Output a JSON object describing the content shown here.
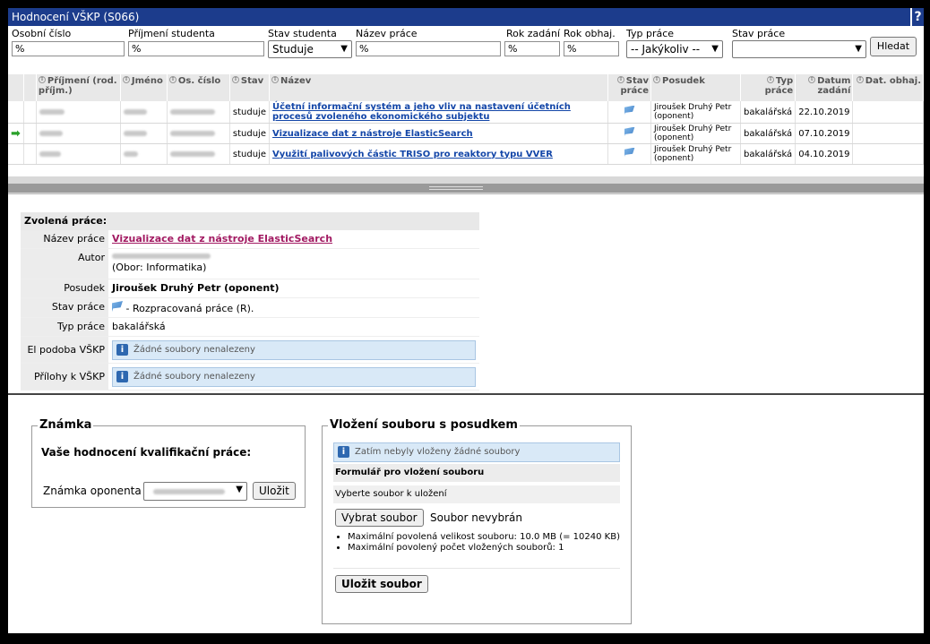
{
  "window_title": "Hodnocení VŠKP (S066)",
  "help_label": "?",
  "filters": {
    "osobni_cislo": {
      "label": "Osobní číslo",
      "value": "%"
    },
    "prijmeni": {
      "label": "Příjmení studenta",
      "value": "%"
    },
    "stav_studenta": {
      "label": "Stav studenta",
      "value": "Studuje"
    },
    "nazev_prace": {
      "label": "Název práce",
      "value": "%"
    },
    "rok_zadani": {
      "label": "Rok zadání",
      "value": "%"
    },
    "rok_obhaj": {
      "label": "Rok obhaj.",
      "value": "%"
    },
    "typ_prace": {
      "label": "Typ práce",
      "value": "-- Jakýkoliv --"
    },
    "stav_prace": {
      "label": "Stav práce",
      "value": ""
    },
    "search_button": "Hledat"
  },
  "table": {
    "headers": {
      "prijmeni": "Příjmení (rod. příjm.)",
      "jmeno": "Jméno",
      "os_cislo": "Os. číslo",
      "stav": "Stav",
      "nazev": "Název",
      "stav_prace": "Stav práce",
      "posudek": "Posudek",
      "typ_prace": "Typ práce",
      "datum_zadani": "Datum zadání",
      "dat_obhaj": "Dat. obhaj."
    },
    "rows": [
      {
        "stav": "studuje",
        "nazev": "Účetní informační systém a jeho vliv na nastavení účetních procesů zvoleného ekonomického subjektu",
        "posudek": "Jiroušek Druhý Petr (oponent)",
        "typ": "bakalářská",
        "datum": "22.10.2019",
        "selected": false
      },
      {
        "stav": "studuje",
        "nazev": "Vizualizace dat z nástroje ElasticSearch",
        "posudek": "Jiroušek Druhý Petr (oponent)",
        "typ": "bakalářská",
        "datum": "07.10.2019",
        "selected": true
      },
      {
        "stav": "studuje",
        "nazev": "Využití palivových částic TRISO pro reaktory typu VVER",
        "posudek": "Jiroušek Druhý Petr (oponent)",
        "typ": "bakalářská",
        "datum": "04.10.2019",
        "selected": false
      }
    ]
  },
  "detail": {
    "header": "Zvolená práce:",
    "nazev_label": "Název práce",
    "nazev_value": "Vizualizace dat z nástroje ElasticSearch",
    "autor_label": "Autor",
    "autor_obor": "(Obor: Informatika)",
    "posudek_label": "Posudek",
    "posudek_value": "Jiroušek Druhý Petr (oponent)",
    "stav_label": "Stav práce",
    "stav_value": " - Rozpracovaná práce (R).",
    "typ_label": "Typ práce",
    "typ_value": "bakalářská",
    "el_podoba_label": "El podoba VŠKP",
    "el_podoba_value": "Žádné soubory nenalezeny",
    "prilohy_label": "Přílohy k VŠKP",
    "prilohy_value": "Žádné soubory nenalezeny"
  },
  "znamka": {
    "legend": "Známka",
    "heading": "Vaše hodnocení kvalifikační práce:",
    "label": "Známka oponenta",
    "save": "Uložit"
  },
  "upload": {
    "legend": "Vložení souboru s posudkem",
    "info": "Zatím nebyly vloženy žádné soubory",
    "form_title": "Formulář pro vložení souboru",
    "choose_label": "Vyberte soubor k uložení",
    "choose_button": "Vybrat soubor",
    "no_file": "Soubor nevybrán",
    "rule1": "Maximální povolená velikost souboru: 10.0 MB (= 10240 KB)",
    "rule2": "Maximální povolený počet vložených souborů: 1",
    "save_button": "Uložit soubor"
  }
}
